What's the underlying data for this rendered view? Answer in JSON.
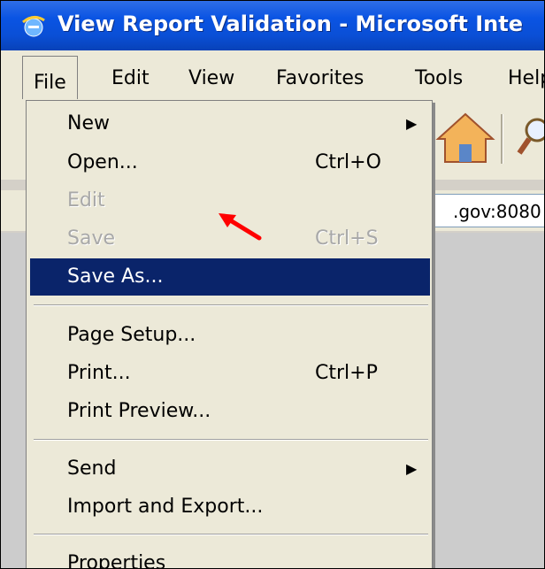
{
  "window": {
    "title": "View Report Validation - Microsoft Internet Explorer",
    "title_visible": "View Report Validation - Microsoft Inte"
  },
  "menubar": {
    "items": [
      {
        "label": "File",
        "open": true
      },
      {
        "label": "Edit"
      },
      {
        "label": "View"
      },
      {
        "label": "Favorites"
      },
      {
        "label": "Tools"
      },
      {
        "label": "Help",
        "label_visible": "Help"
      }
    ]
  },
  "address": {
    "value_visible": ".gov:8080"
  },
  "file_menu": {
    "items": [
      {
        "label": "New",
        "submenu": true
      },
      {
        "label": "Open...",
        "shortcut": "Ctrl+O"
      },
      {
        "label": "Edit",
        "disabled": true
      },
      {
        "label": "Save",
        "shortcut": "Ctrl+S",
        "disabled": true
      },
      {
        "label": "Save As...",
        "highlighted": true
      },
      {
        "label": "Page Setup..."
      },
      {
        "label": "Print...",
        "shortcut": "Ctrl+P"
      },
      {
        "label": "Print Preview..."
      },
      {
        "label": "Send",
        "submenu": true
      },
      {
        "label": "Import and Export..."
      },
      {
        "label": "Properties"
      }
    ]
  },
  "colors": {
    "titlebar": "#0a54e3",
    "menu_bg": "#ece9d8",
    "highlight": "#0a246a",
    "annotation_arrow": "#ff0000"
  },
  "icons": [
    "ie-logo-icon",
    "home-icon",
    "search-icon",
    "submenu-arrow-icon",
    "red-pointer-arrow-icon"
  ]
}
